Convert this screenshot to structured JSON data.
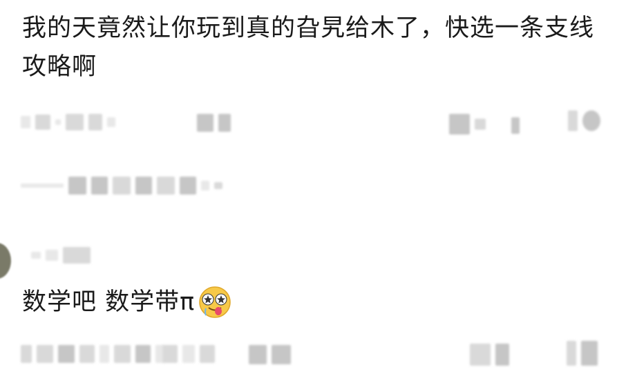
{
  "comments": [
    {
      "text": "我的天竟然让你玩到真的旮旯给木了，快选一条支线攻略啊"
    },
    {
      "text": "数学吧 数学带π",
      "emoji": "drooling-star-eyes-emoji"
    }
  ],
  "colors": {
    "text": "#1a1a1a",
    "blurred_meta": "#d9d9d9",
    "emoji_face": "#f7c948"
  }
}
